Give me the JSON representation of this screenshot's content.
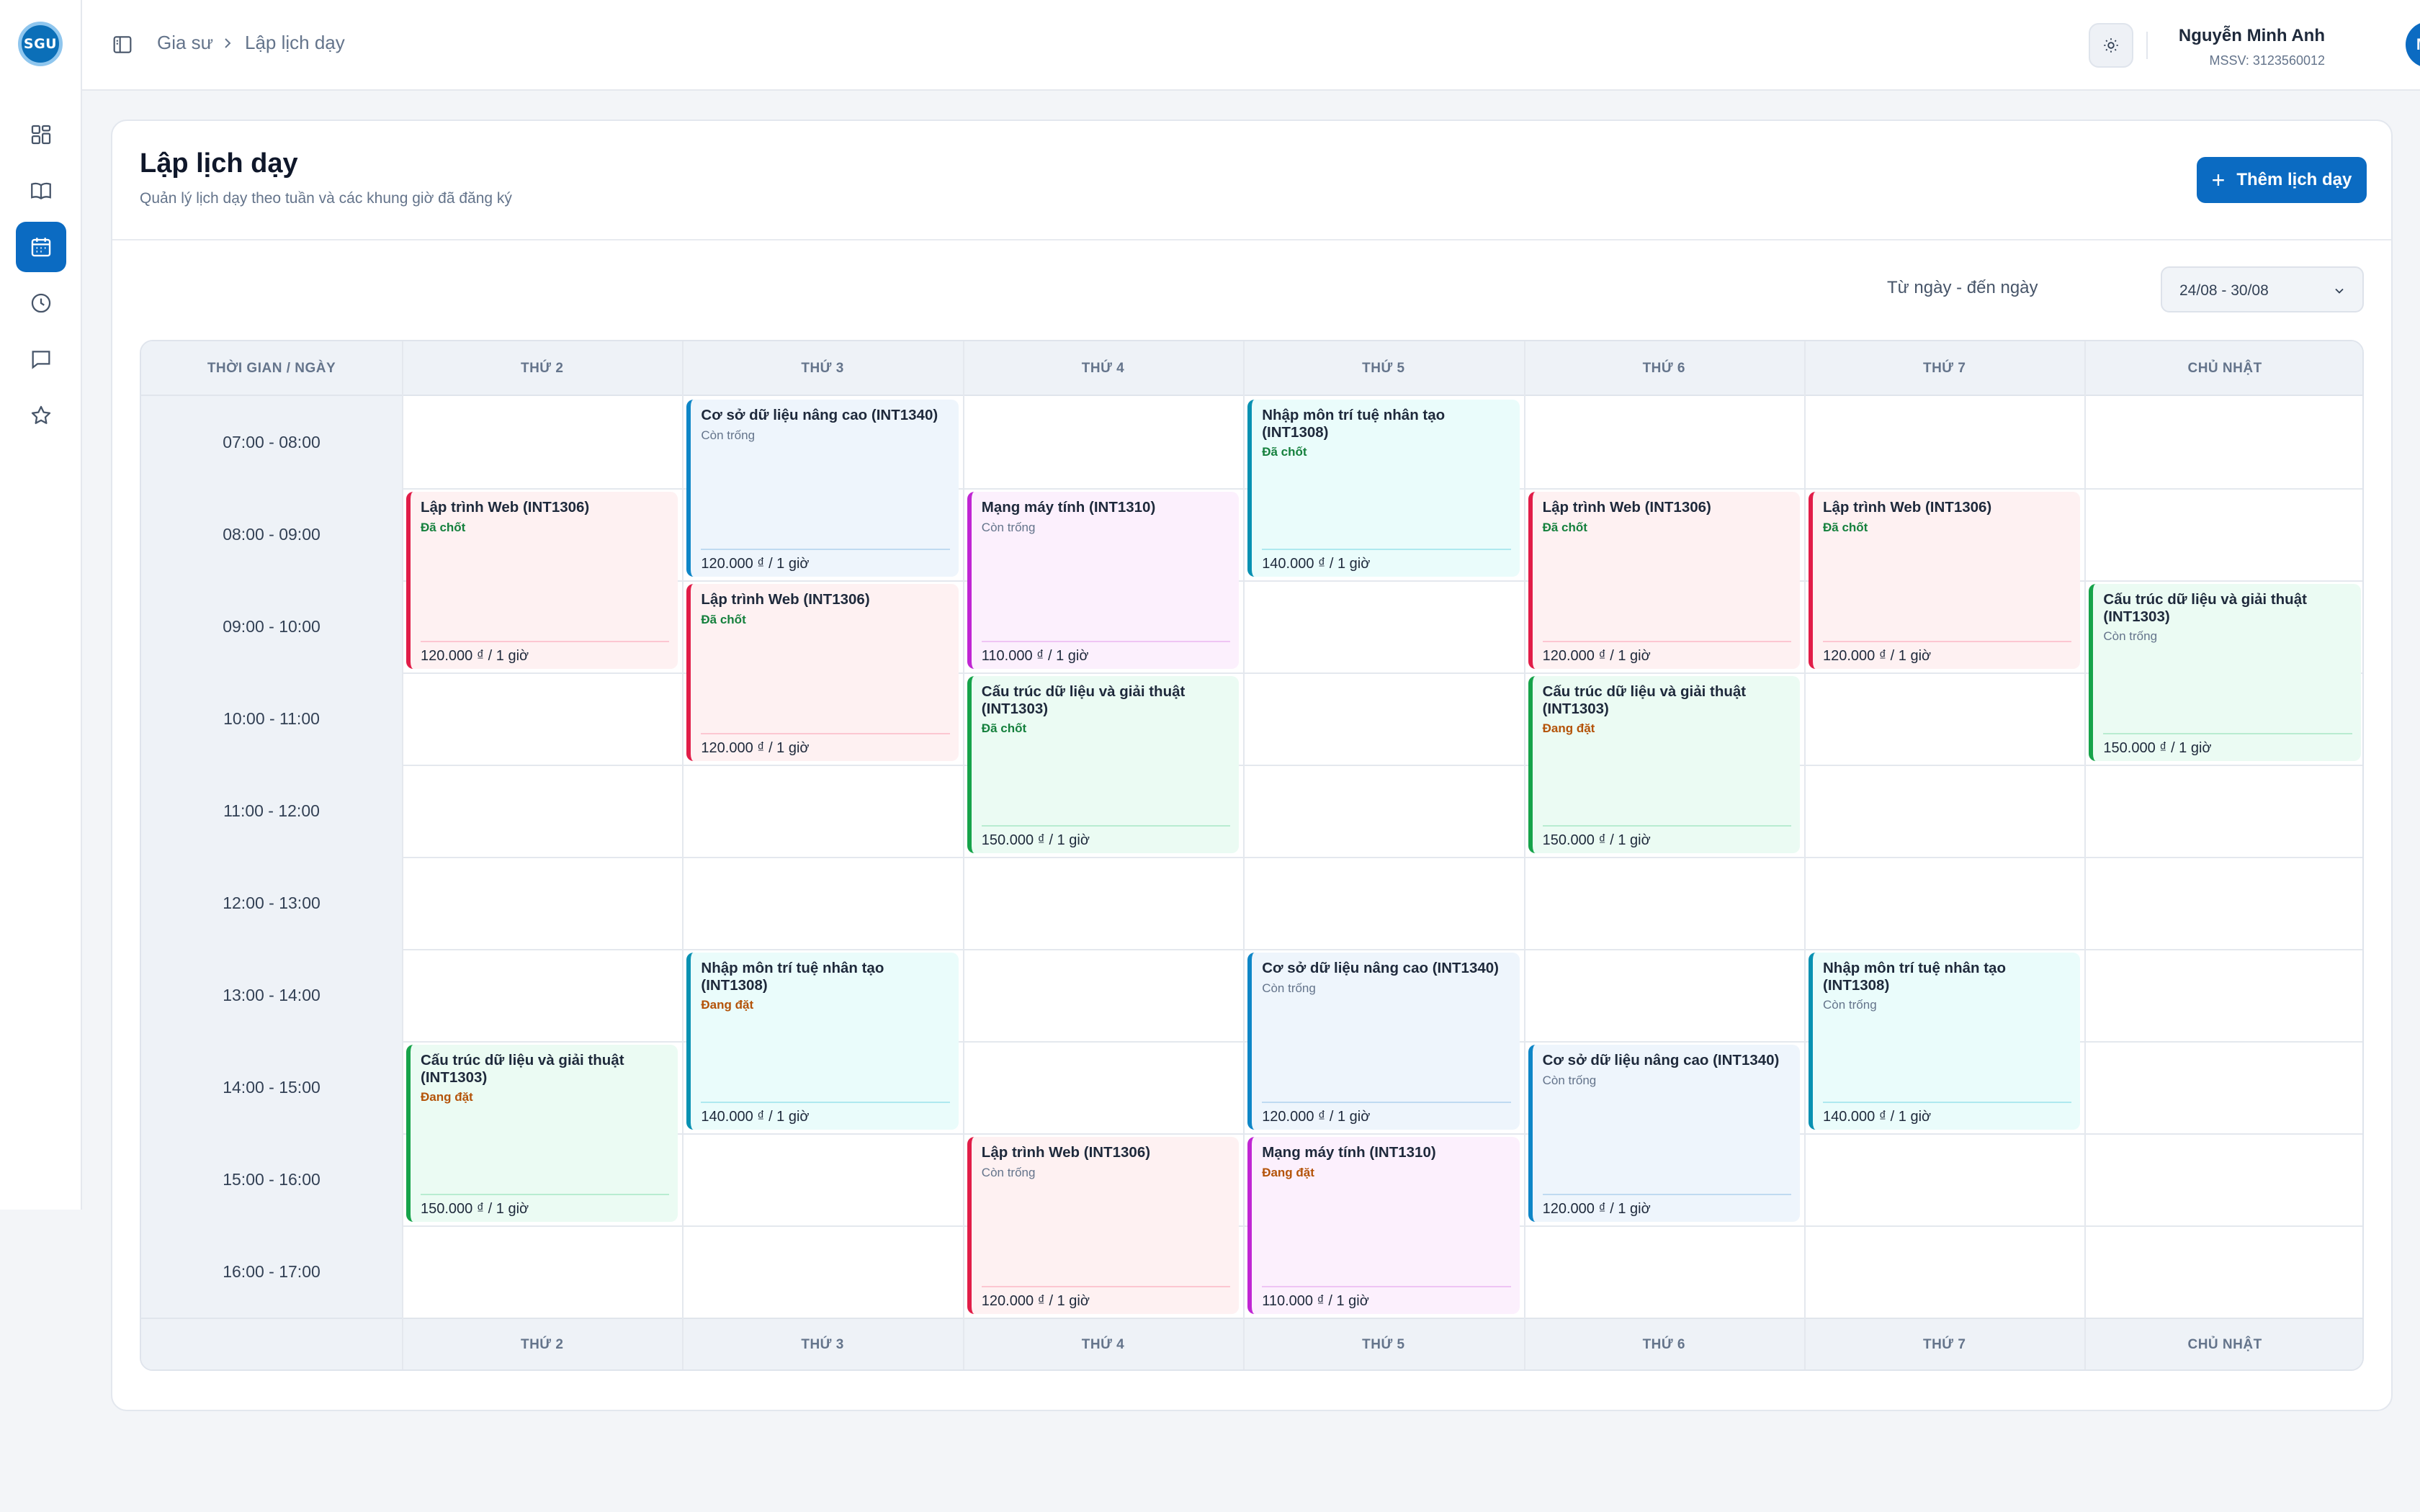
{
  "app": {
    "logo_text": "SGU"
  },
  "sidebar": {
    "items": [
      {
        "icon": "grid-icon"
      },
      {
        "icon": "book-icon"
      },
      {
        "icon": "calendar-icon",
        "active": true
      },
      {
        "icon": "clock-icon"
      },
      {
        "icon": "chat-icon"
      },
      {
        "icon": "star-icon"
      }
    ]
  },
  "header": {
    "breadcrumb": [
      "Gia sư",
      "Lập lịch dạy"
    ],
    "user_name": "Nguyễn Minh Anh",
    "user_id": "MSSV: 3123560012",
    "avatar_initials": "MA"
  },
  "page": {
    "title": "Lập lịch dạy",
    "subtitle": "Quản lý lịch dạy theo tuần và các khung giờ đã đăng ký",
    "add_button": "Thêm lịch dạy",
    "range_label": "Từ ngày - đến ngày",
    "range_value": "24/08 - 30/08"
  },
  "schedule": {
    "corner_label": "THỜI GIAN / NGÀY",
    "days": [
      "THỨ 2",
      "THỨ 3",
      "THỨ 4",
      "THỨ 5",
      "THỨ 6",
      "THỨ 7",
      "CHỦ NHẬT"
    ],
    "times": [
      "07:00 - 08:00",
      "08:00 - 09:00",
      "09:00 - 10:00",
      "10:00 - 11:00",
      "11:00 - 12:00",
      "12:00 - 13:00",
      "13:00 - 14:00",
      "14:00 - 15:00",
      "15:00 - 16:00",
      "16:00 - 17:00"
    ],
    "events": [
      {
        "day": 1,
        "start": 0,
        "span": 2,
        "title": "Cơ sở dữ liệu nâng cao (INT1340)",
        "status": "Còn trống",
        "status_type": "open",
        "price": "120.000 ₫ / 1 giờ",
        "color": "blue"
      },
      {
        "day": 3,
        "start": 0,
        "span": 2,
        "title": "Nhập môn trí tuệ nhân tạo (INT1308)",
        "status": "Đã chốt",
        "status_type": "lock",
        "price": "140.000 ₫ / 1 giờ",
        "color": "cyan"
      },
      {
        "day": 0,
        "start": 1,
        "span": 2,
        "title": "Lập trình Web (INT1306)",
        "status": "Đã chốt",
        "status_type": "lock",
        "price": "120.000 ₫ / 1 giờ",
        "color": "red"
      },
      {
        "day": 2,
        "start": 1,
        "span": 2,
        "title": "Mạng máy tính (INT1310)",
        "status": "Còn trống",
        "status_type": "open",
        "price": "110.000 ₫ / 1 giờ",
        "color": "purple"
      },
      {
        "day": 4,
        "start": 1,
        "span": 2,
        "title": "Lập trình Web (INT1306)",
        "status": "Đã chốt",
        "status_type": "lock",
        "price": "120.000 ₫ / 1 giờ",
        "color": "red"
      },
      {
        "day": 5,
        "start": 1,
        "span": 2,
        "title": "Lập trình Web (INT1306)",
        "status": "Đã chốt",
        "status_type": "lock",
        "price": "120.000 ₫ / 1 giờ",
        "color": "red"
      },
      {
        "day": 1,
        "start": 2,
        "span": 2,
        "title": "Lập trình Web (INT1306)",
        "status": "Đã chốt",
        "status_type": "lock",
        "price": "120.000 ₫ / 1 giờ",
        "color": "red"
      },
      {
        "day": 6,
        "start": 2,
        "span": 2,
        "title": "Cấu trúc dữ liệu và giải thuật (INT1303)",
        "status": "Còn trống",
        "status_type": "open",
        "price": "150.000 ₫ / 1 giờ",
        "color": "green"
      },
      {
        "day": 2,
        "start": 3,
        "span": 2,
        "title": "Cấu trúc dữ liệu và giải thuật (INT1303)",
        "status": "Đã chốt",
        "status_type": "lock",
        "price": "150.000 ₫ / 1 giờ",
        "color": "green"
      },
      {
        "day": 4,
        "start": 3,
        "span": 2,
        "title": "Cấu trúc dữ liệu và giải thuật (INT1303)",
        "status": "Đang đặt",
        "status_type": "pend",
        "price": "150.000 ₫ / 1 giờ",
        "color": "green"
      },
      {
        "day": 1,
        "start": 6,
        "span": 2,
        "title": "Nhập môn trí tuệ nhân tạo (INT1308)",
        "status": "Đang đặt",
        "status_type": "pend",
        "price": "140.000 ₫ / 1 giờ",
        "color": "cyan"
      },
      {
        "day": 3,
        "start": 6,
        "span": 2,
        "title": "Cơ sở dữ liệu nâng cao (INT1340)",
        "status": "Còn trống",
        "status_type": "open",
        "price": "120.000 ₫ / 1 giờ",
        "color": "blue"
      },
      {
        "day": 5,
        "start": 6,
        "span": 2,
        "title": "Nhập môn trí tuệ nhân tạo (INT1308)",
        "status": "Còn trống",
        "status_type": "open",
        "price": "140.000 ₫ / 1 giờ",
        "color": "cyan"
      },
      {
        "day": 0,
        "start": 7,
        "span": 2,
        "title": "Cấu trúc dữ liệu và giải thuật (INT1303)",
        "status": "Đang đặt",
        "status_type": "pend",
        "price": "150.000 ₫ / 1 giờ",
        "color": "green"
      },
      {
        "day": 4,
        "start": 7,
        "span": 2,
        "title": "Cơ sở dữ liệu nâng cao (INT1340)",
        "status": "Còn trống",
        "status_type": "open",
        "price": "120.000 ₫ / 1 giờ",
        "color": "blue"
      },
      {
        "day": 2,
        "start": 8,
        "span": 2,
        "title": "Lập trình Web (INT1306)",
        "status": "Còn trống",
        "status_type": "open",
        "price": "120.000 ₫ / 1 giờ",
        "color": "red"
      },
      {
        "day": 3,
        "start": 8,
        "span": 2,
        "title": "Mạng máy tính (INT1310)",
        "status": "Đang đặt",
        "status_type": "pend",
        "price": "110.000 ₫ / 1 giờ",
        "color": "purple"
      }
    ]
  }
}
